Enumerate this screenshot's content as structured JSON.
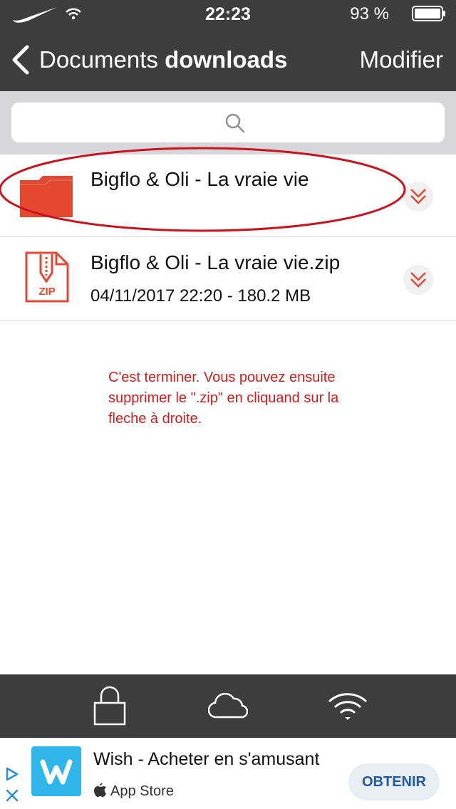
{
  "status_bar": {
    "time": "22:23",
    "battery_percent": "93 %"
  },
  "nav": {
    "back_label": "Documents",
    "folder_name": "downloads",
    "edit_label": "Modifier"
  },
  "search": {
    "icon": "magnifier-icon"
  },
  "files": [
    {
      "name": "Bigflo & Oli - La vraie vie",
      "meta": "",
      "icon": "folder-icon"
    },
    {
      "name": "Bigflo & Oli - La vraie vie.zip",
      "meta": "04/11/2017 22:20 - 180.2 MB",
      "icon": "zip-icon"
    }
  ],
  "annotation": {
    "text": "C'est terminer. Vous pouvez ensuite supprimer le \".zip\" en cliquand sur la fleche à droite.",
    "color": "#cc1f1f"
  },
  "tab_bar": {
    "items": [
      "lock-icon",
      "cloud-icon",
      "wifi-icon"
    ]
  },
  "ad": {
    "title": "Wish - Acheter en s'amusant",
    "store": "App Store",
    "button": "OBTENIR"
  },
  "colors": {
    "bar_bg": "#3d3d3d",
    "accent_red": "#e04a33",
    "search_bg": "#d7d7db",
    "ad_blue": "#2fb7ec"
  }
}
